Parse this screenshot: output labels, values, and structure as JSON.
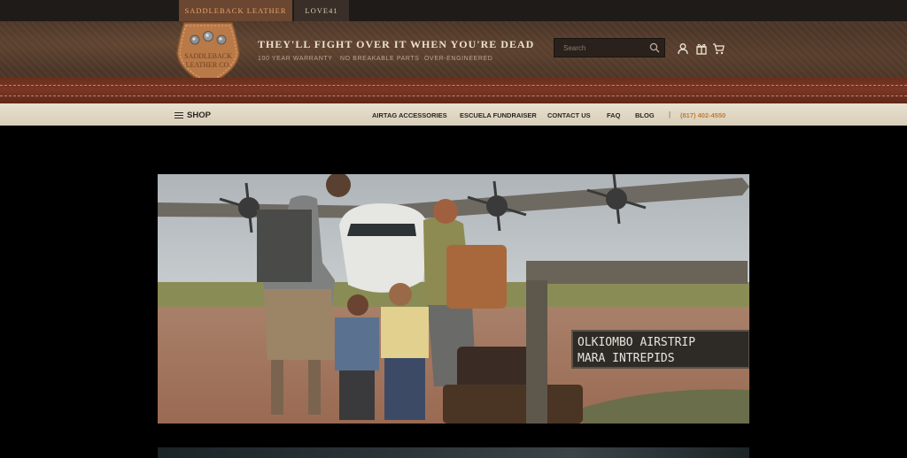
{
  "topbar": {
    "tabs": [
      {
        "label": "SADDLEBACK LEATHER",
        "active": true
      },
      {
        "label": "LOVE41",
        "active": false
      }
    ]
  },
  "header": {
    "logo_text": "SADDLEBACK LEATHER CO.",
    "tagline": "THEY'LL FIGHT OVER IT WHEN YOU'RE DEAD",
    "subtaglines": [
      "100 YEAR WARRANTY",
      "NO BREAKABLE PARTS",
      "OVER-ENGINEERED"
    ],
    "search_placeholder": "Search",
    "icons": [
      "search-icon",
      "user-icon",
      "gift-icon",
      "cart-icon"
    ]
  },
  "nav": {
    "shop_label": "SHOP",
    "links": [
      "AIRTAG ACCESSORIES",
      "ESCUELA FUNDRAISER",
      "CONTACT US",
      "FAQ",
      "BLOG"
    ],
    "separator": "|",
    "phone": "(817) 402-4550"
  },
  "hero": {
    "sign_line1": "OLKIOMBO AIRSTRIP",
    "sign_line2": "MARA INTREPIDS"
  },
  "colors": {
    "accent_orange": "#c67b30",
    "active_tab_bg": "#6b4630",
    "header_leather": "#4c372a",
    "strap_red": "#6b2e1c",
    "nav_cream": "#e3dac8"
  }
}
